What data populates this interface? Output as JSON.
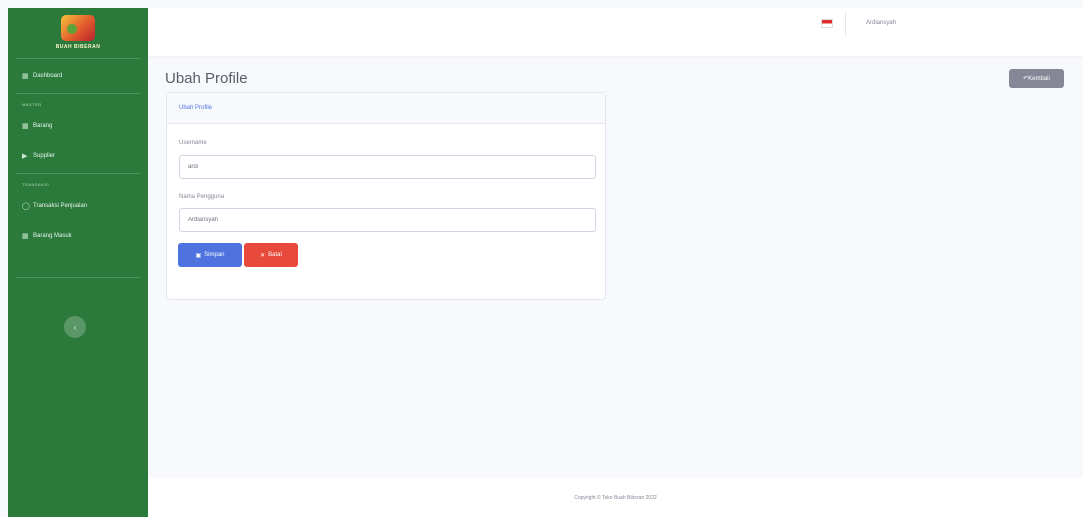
{
  "sidebar": {
    "brand": "BUAH BIBERAN",
    "items": {
      "dashboard": "Dashboard",
      "barang": "Barang",
      "supplier": "Supplier",
      "transaksi": "Transaksi Penjualan",
      "barang_masuk": "Barang Masuk"
    },
    "headings": {
      "master": "MASTER",
      "transaksi": "TRANSAKSI"
    },
    "toggle_icon": "chevron-left-icon"
  },
  "topbar": {
    "user_name": "Ardiansyah"
  },
  "page": {
    "title": "Ubah Profile",
    "back_label": "Kembali"
  },
  "card": {
    "header": "Ubah Profile",
    "username_label": "Username",
    "username_value": "ardi",
    "nama_label": "Nama Pengguna",
    "nama_value": "Ardiansyah",
    "save_label": "Simpan",
    "cancel_label": "Batal"
  },
  "footer": {
    "copyright": "Copyright © Toko Buah Biberan 2022"
  },
  "colors": {
    "sidebar": "#2b7a3c",
    "primary": "#4e73df",
    "danger": "#e74a3b",
    "secondary": "#858796"
  }
}
